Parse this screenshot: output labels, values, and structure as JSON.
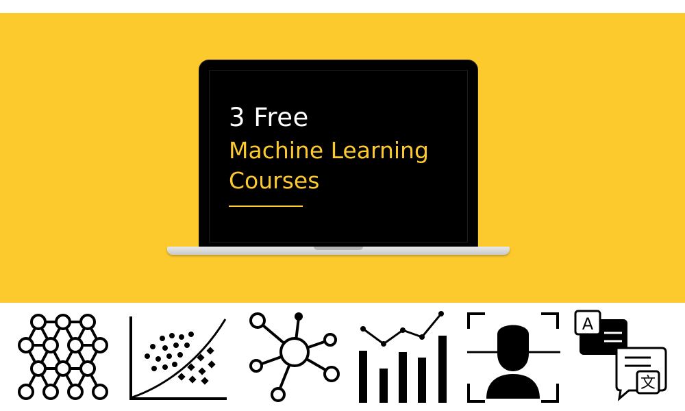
{
  "hero": {
    "line1": "3 Free",
    "line2": "Machine Learning",
    "line3": "Courses"
  },
  "colors": {
    "accent": "#fdca2e",
    "screen": "#000000",
    "background": "#ffffff"
  },
  "icons": [
    "neural-network-icon",
    "scatter-plot-icon",
    "network-node-icon",
    "bar-line-chart-icon",
    "face-recognition-icon",
    "translation-icon"
  ],
  "translation_icon": {
    "letter_a": "A",
    "letter_wen": "文"
  }
}
